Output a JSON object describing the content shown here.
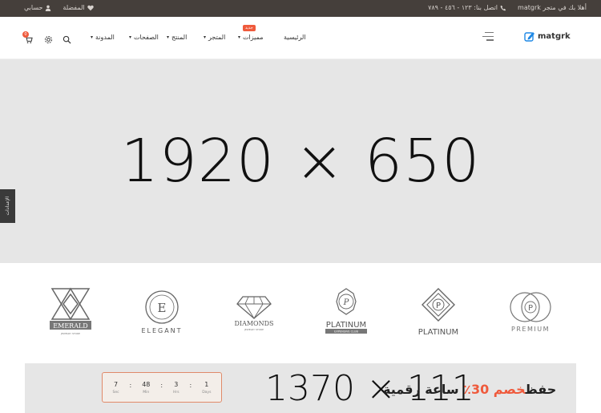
{
  "topbar": {
    "welcome": "أهلا بك في متجر matgrk",
    "contact": "اتصل بنا: ١٢٣ - ٤٥٦ - ٧٨٩",
    "wishlist": "المفضلة",
    "account": "حسابي"
  },
  "header": {
    "logo_text": "matgrk",
    "nav": {
      "home": "الرئيسية",
      "features": "مميزات",
      "features_badge": "جديد",
      "store": "المتجر",
      "product": "المنتج",
      "pages": "الصفحات",
      "blog": "المدونة"
    },
    "cart_count": "0"
  },
  "hero": {
    "placeholder": "1920 × 650"
  },
  "side_tab": {
    "label": "الإعدادات"
  },
  "brands": [
    {
      "name": "EMERALD",
      "sub": "JEWELRY STORE"
    },
    {
      "name": "ELEGANT"
    },
    {
      "name": "DIAMONDS",
      "sub": "JEWELRY STORE"
    },
    {
      "name": "PLATINUM",
      "sub": "EXPENSIVE CLUB"
    },
    {
      "name": "PLATINUM"
    },
    {
      "name": "PREMIUM"
    }
  ],
  "promo": {
    "placeholder": "1370 × 111",
    "title_start": "حفظ",
    "title_accent": "خصم 30٪",
    "title_end": " ساعة رقمية",
    "countdown": {
      "days": "1",
      "days_label": "Days",
      "hours": "3",
      "hours_label": "Hrs",
      "minutes": "48",
      "minutes_label": "Min",
      "seconds": "7",
      "seconds_label": "Sec"
    }
  },
  "colors": {
    "accent": "#ef5a3c",
    "topbar": "#453f3b",
    "placeholder_bg": "#e6e6e6"
  }
}
